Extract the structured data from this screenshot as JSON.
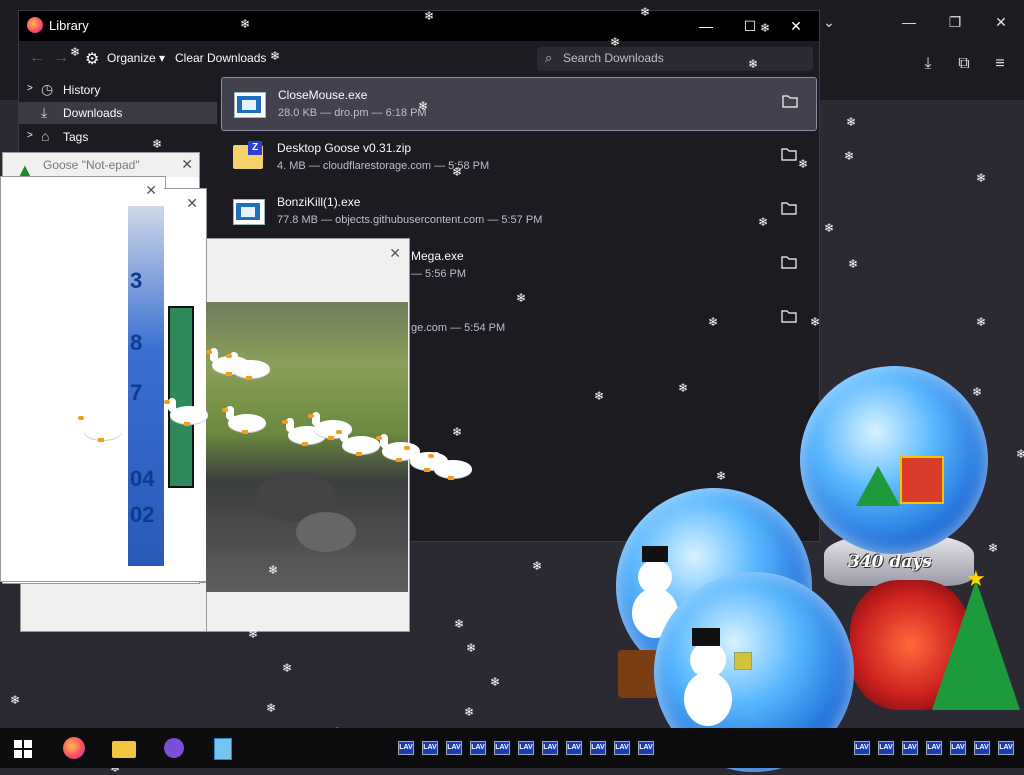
{
  "window": {
    "title": "Library",
    "toolbar": {
      "organize_label": "Organize",
      "clear_downloads_label": "Clear Downloads",
      "search_placeholder": "Search Downloads"
    },
    "sidebar": [
      {
        "label": "History",
        "icon": "clock-icon"
      },
      {
        "label": "Downloads",
        "icon": "download-icon",
        "selected": true
      },
      {
        "label": "Tags",
        "icon": "tag-icon"
      }
    ],
    "downloads": [
      {
        "name": "CloseMouse.exe",
        "meta": "28.0 KB — dro.pm — 6:18 PM",
        "icon": "exe-icon",
        "selected": true
      },
      {
        "name": "Desktop Goose v0.31.zip",
        "meta": "4.  MB — cloudflarestorage.com — 5:58 PM",
        "icon": "zip-icon"
      },
      {
        "name": "BonziKill(1).exe",
        "meta": "77.8 MB — objects.githubusercontent.com — 5:57 PM",
        "icon": "exe-icon"
      },
      {
        "name": "Mega.exe",
        "meta": "— 5:56 PM",
        "icon": "exe-icon"
      },
      {
        "name": "",
        "meta": "ge.com — 5:54 PM",
        "icon": "exe-icon"
      }
    ]
  },
  "goose_notepad": {
    "title": "Goose \"Not-epad\""
  },
  "meme_numbers": [
    "3",
    "8",
    "7",
    "04",
    "02"
  ],
  "snow_globes": {
    "days_label": "340 days"
  },
  "taskbar": {
    "lav_label": "LAV",
    "apps": [
      "windows-start-icon",
      "firefox-icon",
      "file-explorer-icon",
      "bonzi-icon",
      "notepad-icon"
    ]
  },
  "colors": {
    "background": "#2b2a33",
    "chrome": "#1c1b22",
    "selected_row": "#42414d",
    "taskbar": "#0c0c0e"
  }
}
